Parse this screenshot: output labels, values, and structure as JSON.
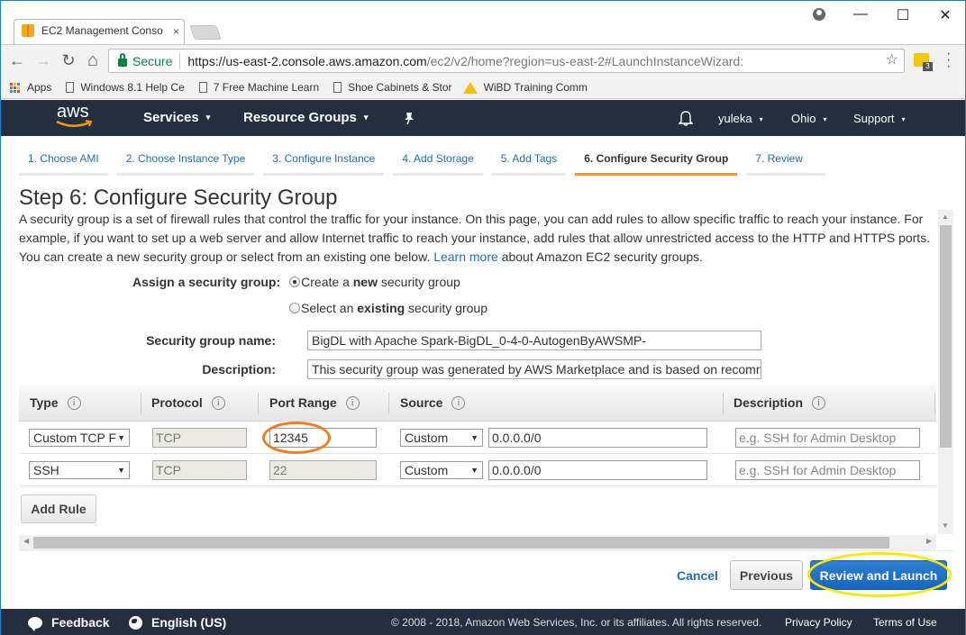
{
  "browser": {
    "tab_title": "EC2 Management Conso",
    "tab_close": "×",
    "secure_label": "Secure",
    "url_scheme_host": "https://us-east-2.console.aws.amazon.com",
    "url_path": "/ec2/v2/home?region=us-east-2#LaunchInstanceWizard:",
    "extension_badge": "3",
    "window_controls": {
      "minimize": "—",
      "maximize": "☐",
      "close": "✕"
    },
    "nav_icons": {
      "back": "←",
      "forward": "→",
      "reload": "↻",
      "home": "⌂",
      "star": "☆"
    },
    "bookmarks": [
      {
        "label": "Apps",
        "icon": "apps-grid-icon"
      },
      {
        "label": "Windows 8.1 Help Ce",
        "icon": "page-icon"
      },
      {
        "label": "7 Free Machine Learn",
        "icon": "page-icon"
      },
      {
        "label": "Shoe Cabinets & Stor",
        "icon": "page-icon"
      },
      {
        "label": "WiBD Training Comm",
        "icon": "google-drive-icon"
      }
    ]
  },
  "aws_nav": {
    "logo": "aws",
    "services": "Services",
    "resource_groups": "Resource Groups",
    "user": "yuleka",
    "region": "Ohio",
    "support": "Support",
    "caret": "▾"
  },
  "wizard": {
    "steps": [
      {
        "label": "1. Choose AMI",
        "active": false
      },
      {
        "label": "2. Choose Instance Type",
        "active": false
      },
      {
        "label": "3. Configure Instance",
        "active": false
      },
      {
        "label": "4. Add Storage",
        "active": false
      },
      {
        "label": "5. Add Tags",
        "active": false
      },
      {
        "label": "6. Configure Security Group",
        "active": true
      },
      {
        "label": "7. Review",
        "active": false
      }
    ],
    "title": "Step 6: Configure Security Group",
    "intro_text": "A security group is a set of firewall rules that control the traffic for your instance. On this page, you can add rules to allow specific traffic to reach your instance. For example, if you want to set up a web server and allow Internet traffic to reach your instance, add rules that allow unrestricted access to the HTTP and HTTPS ports. You can create a new security group or select from an existing one below. ",
    "learn_more": "Learn more",
    "intro_suffix": " about Amazon EC2 security groups."
  },
  "assign": {
    "label": "Assign a security group:",
    "option_new_pre": "Create a ",
    "option_new_bold": "new",
    "option_new_post": " security group",
    "option_existing_pre": "Select an ",
    "option_existing_bold": "existing",
    "option_existing_post": " security group",
    "selected": "new"
  },
  "group_name": {
    "label": "Security group name:",
    "value": "BigDL with Apache Spark-BigDL_0-4-0-AutogenByAWSMP-"
  },
  "group_description": {
    "label": "Description:",
    "value": "This security group was generated by AWS Marketplace and is based on recomn"
  },
  "rules_table": {
    "columns": [
      "Type",
      "Protocol",
      "Port Range",
      "Source",
      "Description"
    ],
    "info_icon": "i",
    "rows": [
      {
        "type": "Custom TCP F",
        "protocol": "TCP",
        "port_range": "12345",
        "source_type": "Custom",
        "source": "0.0.0.0/0",
        "description_placeholder": "e.g. SSH for Admin Desktop"
      },
      {
        "type": "SSH",
        "protocol": "TCP",
        "port_range": "22",
        "source_type": "Custom",
        "source": "0.0.0.0/0",
        "description_placeholder": "e.g. SSH for Admin Desktop"
      }
    ],
    "select_arrow": "▼"
  },
  "actions": {
    "add_rule": "Add Rule",
    "cancel": "Cancel",
    "previous": "Previous",
    "review_launch": "Review and Launch"
  },
  "footer": {
    "feedback": "Feedback",
    "language": "English (US)",
    "copyright": "© 2008 - 2018, Amazon Web Services, Inc. or its affiliates. All rights reserved.",
    "privacy": "Privacy Policy",
    "terms": "Terms of Use"
  },
  "annotations": {
    "highlight_port_color": "#f47a1f",
    "highlight_launch_color": "#ffe800"
  },
  "colors": {
    "aws_nav_bg": "#232f3e",
    "active_step": "#f7981d",
    "link": "#1f6fb5",
    "primary_button": "#1766bf"
  }
}
